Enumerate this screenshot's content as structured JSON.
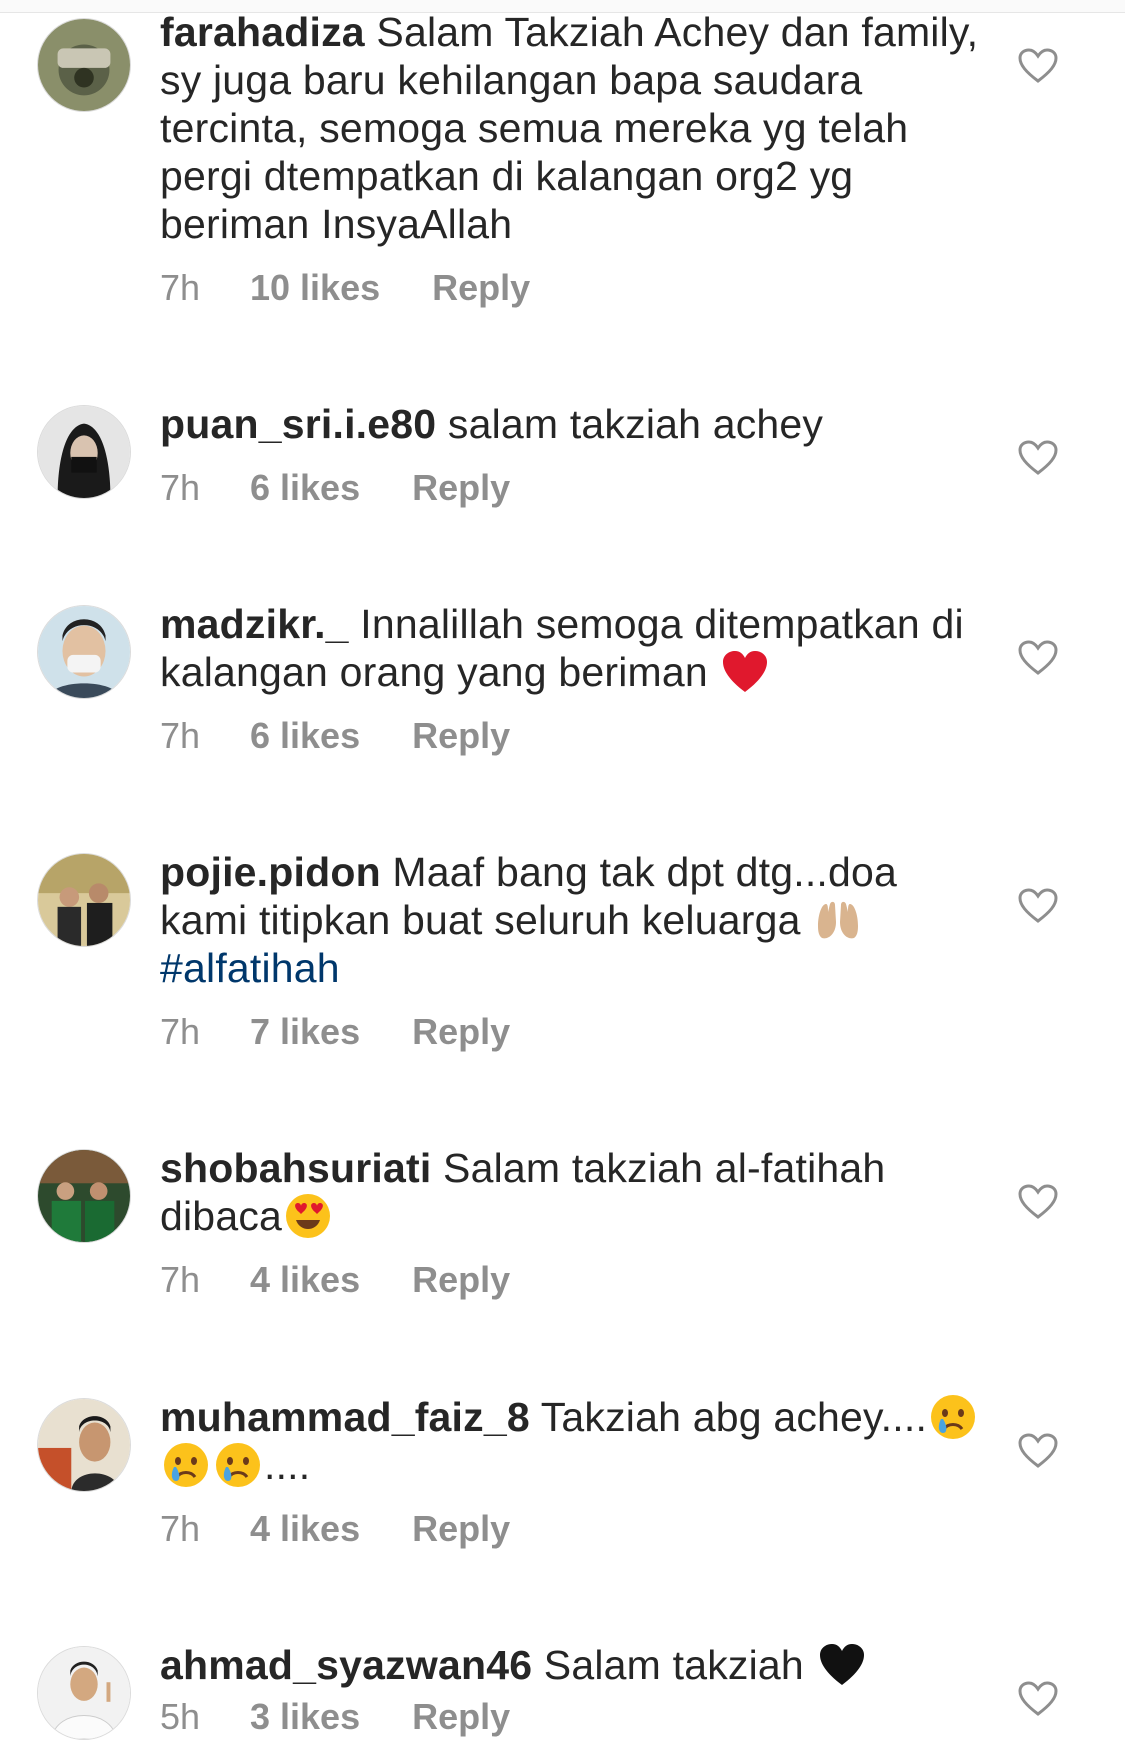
{
  "comments": [
    {
      "username": "farahadiza",
      "text": " Salam Takziah Achey dan family, sy juga baru kehilangan bapa saudara tercinta, semoga semua mereka yg telah pergi dtempatkan di kalangan org2 yg beriman InsyaAllah",
      "time": "7h",
      "likes": "10 likes",
      "reply": "Reply"
    },
    {
      "username": "puan_sri.i.e80",
      "text": " salam takziah achey",
      "time": "7h",
      "likes": "6 likes",
      "reply": "Reply"
    },
    {
      "username": "madzikr._",
      "text": " Innalillah semoga ditempatkan di kalangan orang yang beriman ",
      "emoji": "red-heart-emoji",
      "time": "7h",
      "likes": "6 likes",
      "reply": "Reply"
    },
    {
      "username": "pojie.pidon",
      "text": " Maaf bang tak dpt dtg...doa kami titipkan buat seluruh keluarga ",
      "emoji": "palms-up-emoji",
      "hashtag": "#alfatihah",
      "time": "7h",
      "likes": "7 likes",
      "reply": "Reply"
    },
    {
      "username": "shobahsuriati",
      "text": " Salam takziah al-fatihah dibaca",
      "emoji": "heart-eyes-emoji",
      "time": "7h",
      "likes": "4 likes",
      "reply": "Reply"
    },
    {
      "username": "muhammad_faiz_8",
      "text": " Takziah abg achey....",
      "emoji": "crying-face-emoji",
      "text_after": "....",
      "time": "7h",
      "likes": "4 likes",
      "reply": "Reply"
    },
    {
      "username": "ahmad_syazwan46",
      "text": " Salam takziah ",
      "emoji": "black-heart-emoji",
      "time": "5h",
      "likes": "3 likes",
      "reply": "Reply"
    }
  ],
  "colors": {
    "text": "#262626",
    "meta": "#8e8e8e",
    "hashtag": "#00376b",
    "heart_outline": "#8e8e8e"
  },
  "icons": {
    "like": "heart-outline-icon"
  }
}
